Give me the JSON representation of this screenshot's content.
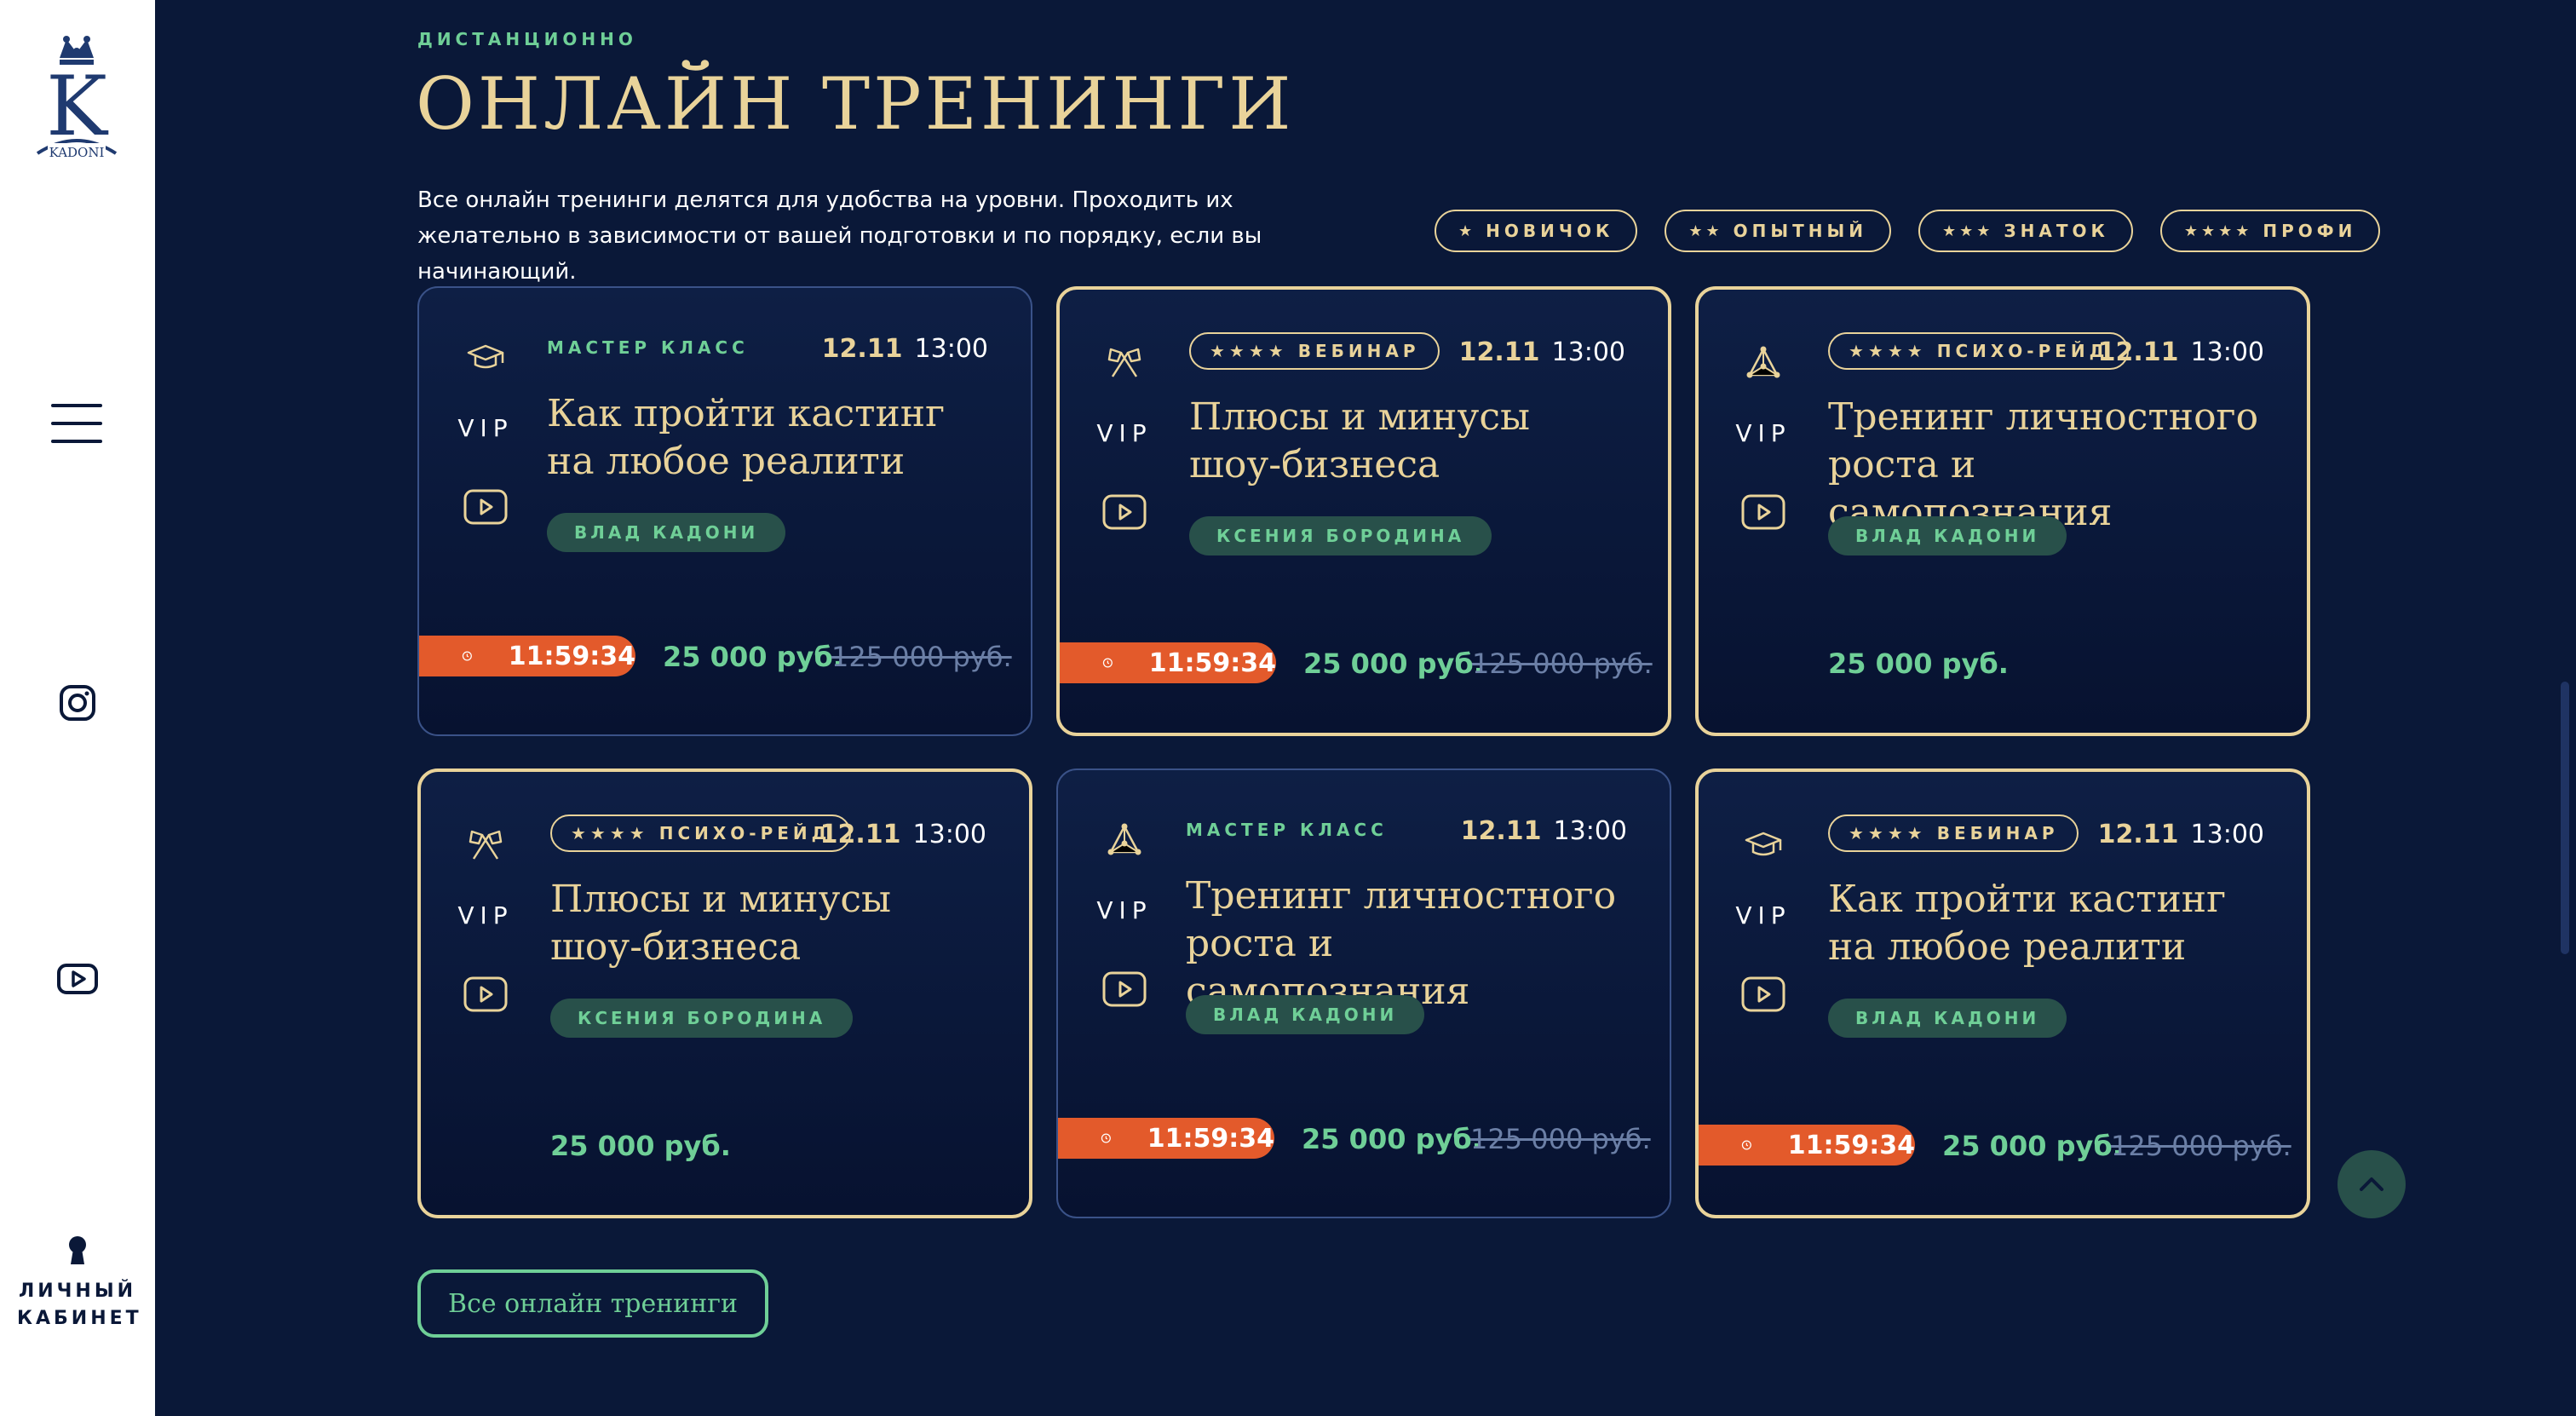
{
  "sidebar": {
    "logo_text": "KADONI",
    "cabinet_label": "ЛИЧНЫЙ КАБИНЕТ"
  },
  "header": {
    "eyebrow": "ДИСТАНЦИОННО",
    "title": "ОНЛАЙН ТРЕНИНГИ",
    "intro": "Все онлайн тренинги делятся для удобства на уровни. Проходить их желательно в зависимости от вашей подготовки и по порядку, если вы начинающий."
  },
  "levels": [
    {
      "stars": "★",
      "label": "НОВИЧОК"
    },
    {
      "stars": "★★",
      "label": "ОПЫТНЫЙ"
    },
    {
      "stars": "★★★",
      "label": "ЗНАТОК"
    },
    {
      "stars": "★★★★",
      "label": "ПРОФИ"
    }
  ],
  "cards": [
    {
      "type": "МАСТЕР КЛАСС",
      "stars": "",
      "date": "12.11",
      "time": "13:00",
      "vip": "VIP",
      "title": "Как пройти кастинг на любое реалити",
      "author": "ВЛАД КАДОНИ",
      "timer": "11:59:34",
      "price": "25 000 руб.",
      "old_price": "125 000 руб.",
      "icon": "graduation-cap-icon"
    },
    {
      "type": "ВЕБИНАР",
      "stars": "★★★★",
      "date": "12.11",
      "time": "13:00",
      "vip": "VIP",
      "title": "Плюсы и минусы шоу-бизнеса",
      "author": "КСЕНИЯ БОРОДИНА",
      "timer": "11:59:34",
      "price": "25 000 руб.",
      "old_price": "125 000 руб.",
      "icon": "crossed-flags-icon"
    },
    {
      "type": "ПСИХО-РЕЙД",
      "stars": "★★★★",
      "date": "12.11",
      "time": "13:00",
      "vip": "VIP",
      "title": "Тренинг личностного роста и самопознания",
      "author": "ВЛАД КАДОНИ",
      "timer": "",
      "price": "25 000 руб.",
      "old_price": "",
      "icon": "triangle-network-icon"
    },
    {
      "type": "ПСИХО-РЕЙД",
      "stars": "★★★★",
      "date": "12.11",
      "time": "13:00",
      "vip": "VIP",
      "title": "Плюсы и минусы шоу-бизнеса",
      "author": "КСЕНИЯ БОРОДИНА",
      "timer": "",
      "price": "25 000 руб.",
      "old_price": "",
      "icon": "crossed-flags-icon"
    },
    {
      "type": "МАСТЕР КЛАСС",
      "stars": "",
      "date": "12.11",
      "time": "13:00",
      "vip": "VIP",
      "title": "Тренинг личностного роста и самопознания",
      "author": "ВЛАД КАДОНИ",
      "timer": "11:59:34",
      "price": "25 000 руб.",
      "old_price": "125 000 руб.",
      "icon": "triangle-network-icon"
    },
    {
      "type": "ВЕБИНАР",
      "stars": "★★★★",
      "date": "12.11",
      "time": "13:00",
      "vip": "VIP",
      "title": "Как пройти кастинг на любое реалити",
      "author": "ВЛАД КАДОНИ",
      "timer": "11:59:34",
      "price": "25 000 руб.",
      "old_price": "125 000 руб.",
      "icon": "graduation-cap-icon"
    }
  ],
  "all_button": "Все онлайн тренинги",
  "colors": {
    "background": "#0a1838",
    "gold": "#e9d39a",
    "green": "#6fcf97",
    "timer": "#e35a2b",
    "author_badge": "#28504a"
  }
}
